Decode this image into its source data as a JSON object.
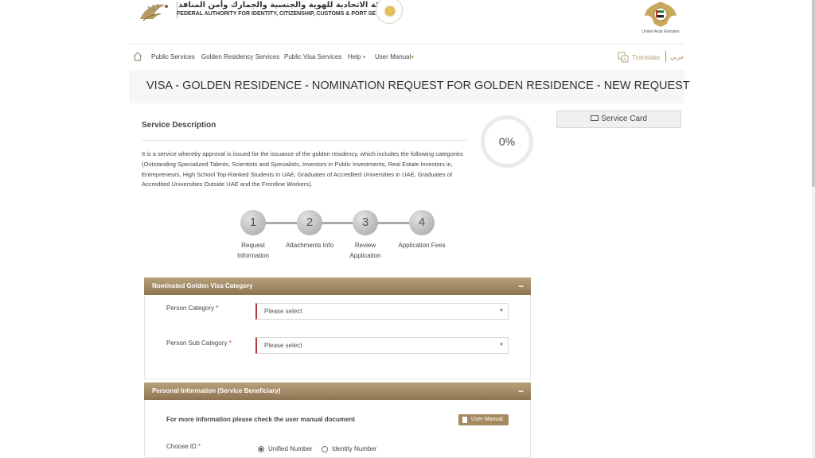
{
  "header": {
    "authority_ar": "الهيئة الاتحادية للهوية والجنسية والجمارك وأمن المنافذ",
    "authority_en": "FEDERAL AUTHORITY FOR IDENTITY, CITIZENSHIP, CUSTOMS & PORT SECURITY",
    "emblem_caption": "United Arab Emirates"
  },
  "nav": {
    "items": [
      {
        "label": "Public Services"
      },
      {
        "label": "Golden Residency Services"
      },
      {
        "label": "Public Visa Services"
      },
      {
        "label": "Help",
        "caret": "▾"
      },
      {
        "label": "User Manual",
        "caret": "▾"
      }
    ],
    "translate": "Translate",
    "language": "عربي"
  },
  "page": {
    "title": "VISA - GOLDEN RESIDENCE - NOMINATION REQUEST FOR GOLDEN RESIDENCE - NEW REQUEST"
  },
  "service": {
    "heading": "Service Description",
    "description": "It is a service whereby approval is issued for the issuance of the golden residency, which includes the following categories (Outstanding Specialized Talents, Scientists and Specialists, Investors in Public Investments, Real Estate Investors in, Entrepreneurs, High School Top-Ranked Students in UAE, Graduates of Accredited Universities in UAE, Graduates of Accredited Universities Outside UAE and the Frontline Workers).",
    "progress": "0%",
    "card_button": "Service Card"
  },
  "steps": [
    {
      "number": "1",
      "label": "Request Information"
    },
    {
      "number": "2",
      "label": "Attachments Info"
    },
    {
      "number": "3",
      "label": "Review Application"
    },
    {
      "number": "4",
      "label": "Application Fees"
    }
  ],
  "nominated_panel": {
    "title": "Nominated Golden Visa Category",
    "collapse": "−",
    "person_category_label": "Person Category",
    "person_category_value": "Please select",
    "person_sub_category_label": "Person Sub Category",
    "person_sub_category_value": "Please select",
    "required_mark": "*"
  },
  "personal_panel": {
    "title": "Personal Information (Service Beneficiary)",
    "collapse": "−",
    "info_text": "For more information please check the user manual document",
    "manual_button": "User Manual",
    "choose_id_label": "Choose ID",
    "required_mark": "*",
    "options": [
      {
        "label": "Unified Number",
        "selected": true
      },
      {
        "label": "Identity Number",
        "selected": false
      }
    ]
  },
  "colors": {
    "brand_gold": "#b38a4a",
    "panel_header": "#8d7451",
    "required": "#c0392b"
  }
}
